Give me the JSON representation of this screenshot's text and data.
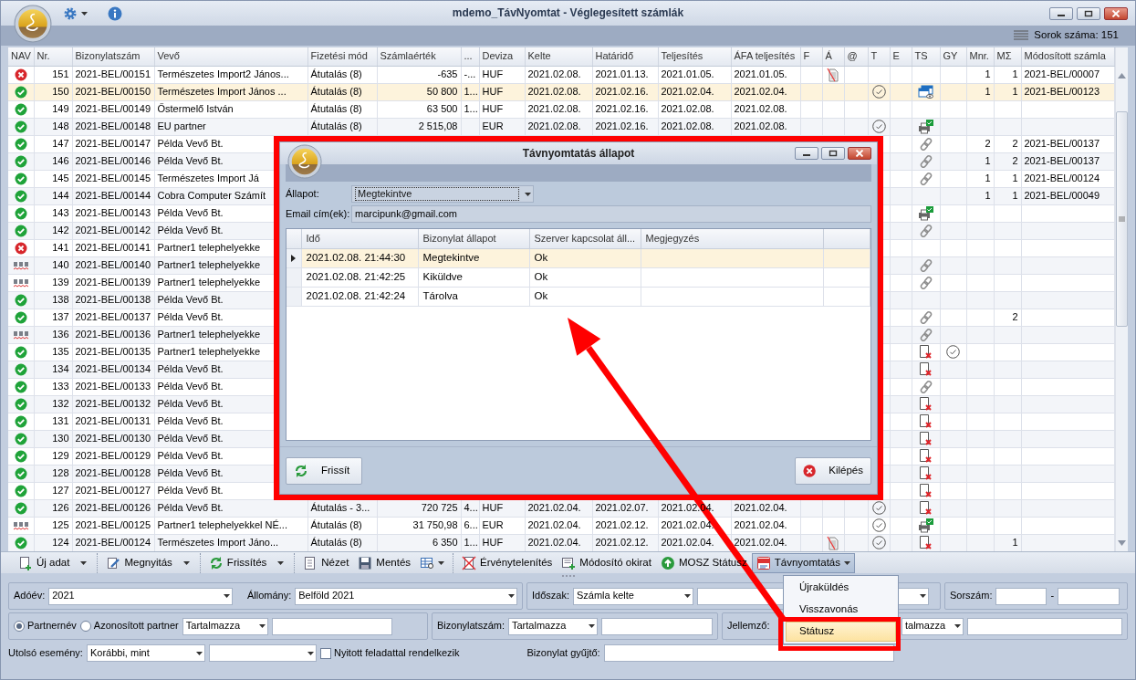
{
  "window": {
    "title": "mdemo_TávNyomtat - Véglegesített számlák"
  },
  "row_count": "Sorok száma: 151",
  "grid": {
    "columns": [
      "NAV",
      "Nr.",
      "Bizonylatszám",
      "Vevő",
      "Fizetési mód",
      "Számlaérték",
      "...",
      "Deviza",
      "Kelte",
      "Határidő",
      "Teljesítés",
      "ÁFA teljesítés",
      "F",
      "Á",
      "@",
      "T",
      "E",
      "TS",
      "GY",
      "Mnr.",
      "MΣ",
      "Módosított számla"
    ],
    "rows": [
      {
        "nav": {
          "kind": "error"
        },
        "nr": "151",
        "number": "2021-BEL/00151",
        "customer": "Természetes Import2 János...",
        "payment": "Átutalás (8)",
        "amount": "-635",
        "col_7": "-...",
        "currency": "HUF",
        "issued": "2021.02.08.",
        "due": "2021.01.13.",
        "fulfilled": "2021.01.05.",
        "vat_date": "2021.01.05.",
        "a_icon": true,
        "t_check": false,
        "gy_check": false,
        "mnr": "1",
        "msum": "1",
        "modified": "2021-BEL/00007",
        "selected": false
      },
      {
        "nav": {
          "kind": "ok"
        },
        "nr": "150",
        "number": "2021-BEL/00150",
        "customer": "Természetes Import János ...",
        "payment": "Átutalás (8)",
        "amount": "50 800",
        "col_7": "1...",
        "currency": "HUF",
        "issued": "2021.02.08.",
        "due": "2021.02.16.",
        "fulfilled": "2021.02.04.",
        "vat_date": "2021.02.04.",
        "a_icon": false,
        "t_check": true,
        "ts": {
          "kind": "window"
        },
        "gy_check": false,
        "mnr": "1",
        "msum": "1",
        "modified": "2021-BEL/00123",
        "selected": true
      },
      {
        "nav": {
          "kind": "ok"
        },
        "nr": "149",
        "number": "2021-BEL/00149",
        "customer": "Őstermelő István",
        "payment": "Átutalás (8)",
        "amount": "63 500",
        "col_7": "1...",
        "currency": "HUF",
        "issued": "2021.02.08.",
        "due": "2021.02.16.",
        "fulfilled": "2021.02.08.",
        "vat_date": "2021.02.08.",
        "a_icon": false,
        "t_check": false,
        "gy_check": false,
        "selected": false
      },
      {
        "nav": {
          "kind": "ok"
        },
        "nr": "148",
        "number": "2021-BEL/00148",
        "customer": "EU partner",
        "payment": "Átutalás (8)",
        "amount": "2 515,08",
        "currency": "EUR",
        "issued": "2021.02.08.",
        "due": "2021.02.16.",
        "fulfilled": "2021.02.08.",
        "vat_date": "2021.02.08.",
        "a_icon": false,
        "t_check": true,
        "ts": {
          "kind": "printer"
        },
        "gy_check": false,
        "selected": false
      },
      {
        "nav": {
          "kind": "ok"
        },
        "nr": "147",
        "number": "2021-BEL/00147",
        "customer": "Példa Vevő Bt.",
        "gy_check": false,
        "ts": {
          "kind": "link"
        },
        "mnr": "2",
        "msum": "2",
        "modified": "2021-BEL/00137",
        "selected": false
      },
      {
        "nav": {
          "kind": "ok"
        },
        "nr": "146",
        "number": "2021-BEL/00146",
        "customer": "Példa Vevő Bt.",
        "gy_check": false,
        "ts": {
          "kind": "link"
        },
        "mnr": "1",
        "msum": "2",
        "modified": "2021-BEL/00137",
        "selected": false
      },
      {
        "nav": {
          "kind": "ok"
        },
        "nr": "145",
        "number": "2021-BEL/00145",
        "customer": "Természetes Import Já",
        "gy_check": false,
        "ts": {
          "kind": "link"
        },
        "mnr": "1",
        "msum": "1",
        "modified": "2021-BEL/00124",
        "selected": false
      },
      {
        "nav": {
          "kind": "ok"
        },
        "nr": "144",
        "number": "2021-BEL/00144",
        "customer": "Cobra Computer Számít",
        "gy_check": false,
        "mnr": "1",
        "msum": "1",
        "modified": "2021-BEL/00049",
        "selected": false
      },
      {
        "nav": {
          "kind": "ok"
        },
        "nr": "143",
        "number": "2021-BEL/00143",
        "customer": "Példa Vevő Bt.",
        "gy_check": false,
        "ts": {
          "kind": "printer"
        },
        "selected": false
      },
      {
        "nav": {
          "kind": "ok"
        },
        "nr": "142",
        "number": "2021-BEL/00142",
        "customer": "Példa Vevő Bt.",
        "gy_check": false,
        "ts": {
          "kind": "link"
        },
        "selected": false
      },
      {
        "nav": {
          "kind": "error"
        },
        "nr": "141",
        "number": "2021-BEL/00141",
        "customer": "Partner1 telephelyekke",
        "gy_check": false,
        "selected": false
      },
      {
        "nav": {
          "kind": "abc"
        },
        "nr": "140",
        "number": "2021-BEL/00140",
        "customer": "Partner1 telephelyekke",
        "gy_check": false,
        "ts": {
          "kind": "link"
        },
        "selected": false
      },
      {
        "nav": {
          "kind": "abc"
        },
        "nr": "139",
        "number": "2021-BEL/00139",
        "customer": "Partner1 telephelyekke",
        "gy_check": false,
        "ts": {
          "kind": "link"
        },
        "selected": false
      },
      {
        "nav": {
          "kind": "ok"
        },
        "nr": "138",
        "number": "2021-BEL/00138",
        "customer": "Példa Vevő Bt.",
        "gy_check": false,
        "selected": false
      },
      {
        "nav": {
          "kind": "ok"
        },
        "nr": "137",
        "number": "2021-BEL/00137",
        "customer": "Példa Vevő Bt.",
        "gy_check": false,
        "ts": {
          "kind": "link"
        },
        "msum": "2",
        "selected": false
      },
      {
        "nav": {
          "kind": "abc"
        },
        "nr": "136",
        "number": "2021-BEL/00136",
        "customer": "Partner1 telephelyekke",
        "gy_check": false,
        "ts": {
          "kind": "link"
        },
        "selected": false
      },
      {
        "nav": {
          "kind": "ok"
        },
        "nr": "135",
        "number": "2021-BEL/00135",
        "customer": "Partner1 telephelyekke",
        "gy_check": true,
        "ts": {
          "kind": "doc_error"
        },
        "selected": false
      },
      {
        "nav": {
          "kind": "ok"
        },
        "nr": "134",
        "number": "2021-BEL/00134",
        "customer": "Példa Vevő Bt.",
        "gy_check": false,
        "ts": {
          "kind": "doc_error"
        },
        "selected": false
      },
      {
        "nav": {
          "kind": "ok"
        },
        "nr": "133",
        "number": "2021-BEL/00133",
        "customer": "Példa Vevő Bt.",
        "gy_check": false,
        "ts": {
          "kind": "link"
        },
        "selected": false
      },
      {
        "nav": {
          "kind": "ok"
        },
        "nr": "132",
        "number": "2021-BEL/00132",
        "customer": "Példa Vevő Bt.",
        "gy_check": false,
        "ts": {
          "kind": "doc_error"
        },
        "selected": false
      },
      {
        "nav": {
          "kind": "ok"
        },
        "nr": "131",
        "number": "2021-BEL/00131",
        "customer": "Példa Vevő Bt.",
        "gy_check": false,
        "ts": {
          "kind": "doc_error"
        },
        "selected": false
      },
      {
        "nav": {
          "kind": "ok"
        },
        "nr": "130",
        "number": "2021-BEL/00130",
        "customer": "Példa Vevő Bt.",
        "gy_check": false,
        "ts": {
          "kind": "doc_error"
        },
        "selected": false
      },
      {
        "nav": {
          "kind": "ok"
        },
        "nr": "129",
        "number": "2021-BEL/00129",
        "customer": "Példa Vevő Bt.",
        "gy_check": false,
        "ts": {
          "kind": "doc_error"
        },
        "selected": false
      },
      {
        "nav": {
          "kind": "ok"
        },
        "nr": "128",
        "number": "2021-BEL/00128",
        "customer": "Példa Vevő Bt.",
        "gy_check": false,
        "ts": {
          "kind": "doc_error"
        },
        "selected": false
      },
      {
        "nav": {
          "kind": "ok"
        },
        "nr": "127",
        "number": "2021-BEL/00127",
        "customer": "Példa Vevő Bt.",
        "gy_check": false,
        "ts": {
          "kind": "doc_error"
        },
        "selected": false
      },
      {
        "nav": {
          "kind": "ok"
        },
        "nr": "126",
        "number": "2021-BEL/00126",
        "customer": "Példa Vevő Bt.",
        "payment": "Átutalás - 3...",
        "amount": "720 725",
        "col_7": "4...",
        "currency": "HUF",
        "issued": "2021.02.04.",
        "due": "2021.02.07.",
        "fulfilled": "2021.02.04.",
        "vat_date": "2021.02.04.",
        "a_icon": false,
        "t_check": true,
        "ts": {
          "kind": "doc_error"
        },
        "gy_check": false,
        "selected": false
      },
      {
        "nav": {
          "kind": "abc"
        },
        "nr": "125",
        "number": "2021-BEL/00125",
        "customer": "Partner1 telephelyekkel NÉ...",
        "payment": "Átutalás (8)",
        "amount": "31 750,98",
        "col_7": "6...",
        "currency": "EUR",
        "issued": "2021.02.04.",
        "due": "2021.02.12.",
        "fulfilled": "2021.02.04.",
        "vat_date": "2021.02.04.",
        "a_icon": false,
        "t_check": true,
        "ts": {
          "kind": "printer"
        },
        "gy_check": false,
        "selected": false
      },
      {
        "nav": {
          "kind": "ok"
        },
        "nr": "124",
        "number": "2021-BEL/00124",
        "customer": "Természetes Import Jáno...",
        "payment": "Átutalás (8)",
        "amount": "6 350",
        "col_7": "1...",
        "currency": "HUF",
        "issued": "2021.02.04.",
        "due": "2021.02.12.",
        "fulfilled": "2021.02.04.",
        "vat_date": "2021.02.04.",
        "a_icon": true,
        "t_check": true,
        "ts": {
          "kind": "doc_error"
        },
        "gy_check": false,
        "msum": "1",
        "selected": false
      }
    ]
  },
  "toolbar": [
    {
      "items": [
        {
          "label": "Új adat",
          "kind": "split"
        }
      ]
    },
    {
      "items": [
        {
          "label": "Megnyitás",
          "kind": "split"
        }
      ]
    },
    {
      "items": [
        {
          "label": "Frissítés",
          "kind": "split"
        }
      ]
    },
    {
      "items": [
        {
          "label": "Nézet",
          "kind": "button"
        },
        {
          "label": "Mentés",
          "kind": "button"
        },
        {
          "kind": "icon_dropdown"
        }
      ]
    },
    {
      "items": [
        {
          "label": "Érvénytelenítés",
          "kind": "button"
        },
        {
          "label": "Módosító okirat",
          "kind": "button"
        },
        {
          "label": "MOSZ Státusz",
          "kind": "button"
        },
        {
          "label": "Távnyomtatás",
          "kind": "dropdown",
          "expanded": true
        }
      ]
    }
  ],
  "menu": {
    "items": [
      {
        "label": "Újraküldés",
        "selected": false
      },
      {
        "label": "Visszavonás",
        "selected": false
      },
      {
        "label": "Státusz",
        "selected": true
      }
    ]
  },
  "filters": {
    "year_label": "Adóév:",
    "year": "2021",
    "store_label": "Állomány:",
    "store": "Belföld 2021",
    "period_label": "Időszak:",
    "period": "Számla kelte",
    "serial_label": "Sorszám:",
    "serial_dash": "-",
    "partner_modes": [
      {
        "label": "Partnernév",
        "selected": true
      },
      {
        "label": "Azonosított partner",
        "selected": false
      }
    ],
    "partner_match": "Tartalmazza",
    "doc_number_label": "Bizonylatszám:",
    "doc_number_match": "Tartalmazza",
    "feature_label": "Jellemző:",
    "feature_match": "talmazza",
    "last_event_label": "Utolsó esemény:",
    "last_event": "Korábbi, mint",
    "open_task": {
      "label": "Nyitott feladattal rendelkezik",
      "checked": false
    },
    "collector_label": "Bizonylat gyűjtő:"
  },
  "dialog": {
    "title": "Távnyomtatás állapot",
    "status_label": "Állapot:",
    "status": "Megtekintve",
    "status_disabled": true,
    "email_label": "Email cím(ek):",
    "email": "marcipunk@gmail.com",
    "columns": [
      "Idő",
      "Bizonylat állapot",
      "Szerver kapcsolat áll...",
      "Megjegyzés"
    ],
    "rows": [
      {
        "time": "2021.02.08. 21:44:30",
        "state": "Megtekintve",
        "server": "Ok",
        "selected": true
      },
      {
        "time": "2021.02.08. 21:42:25",
        "state": "Kiküldve",
        "server": "Ok",
        "selected": false
      },
      {
        "time": "2021.02.08. 21:42:24",
        "state": "Tárolva",
        "server": "Ok",
        "selected": false
      }
    ],
    "buttons": [
      {
        "label": "Frissít",
        "kind": "refresh"
      },
      {
        "label": "Kilépés",
        "kind": "exit"
      }
    ]
  }
}
